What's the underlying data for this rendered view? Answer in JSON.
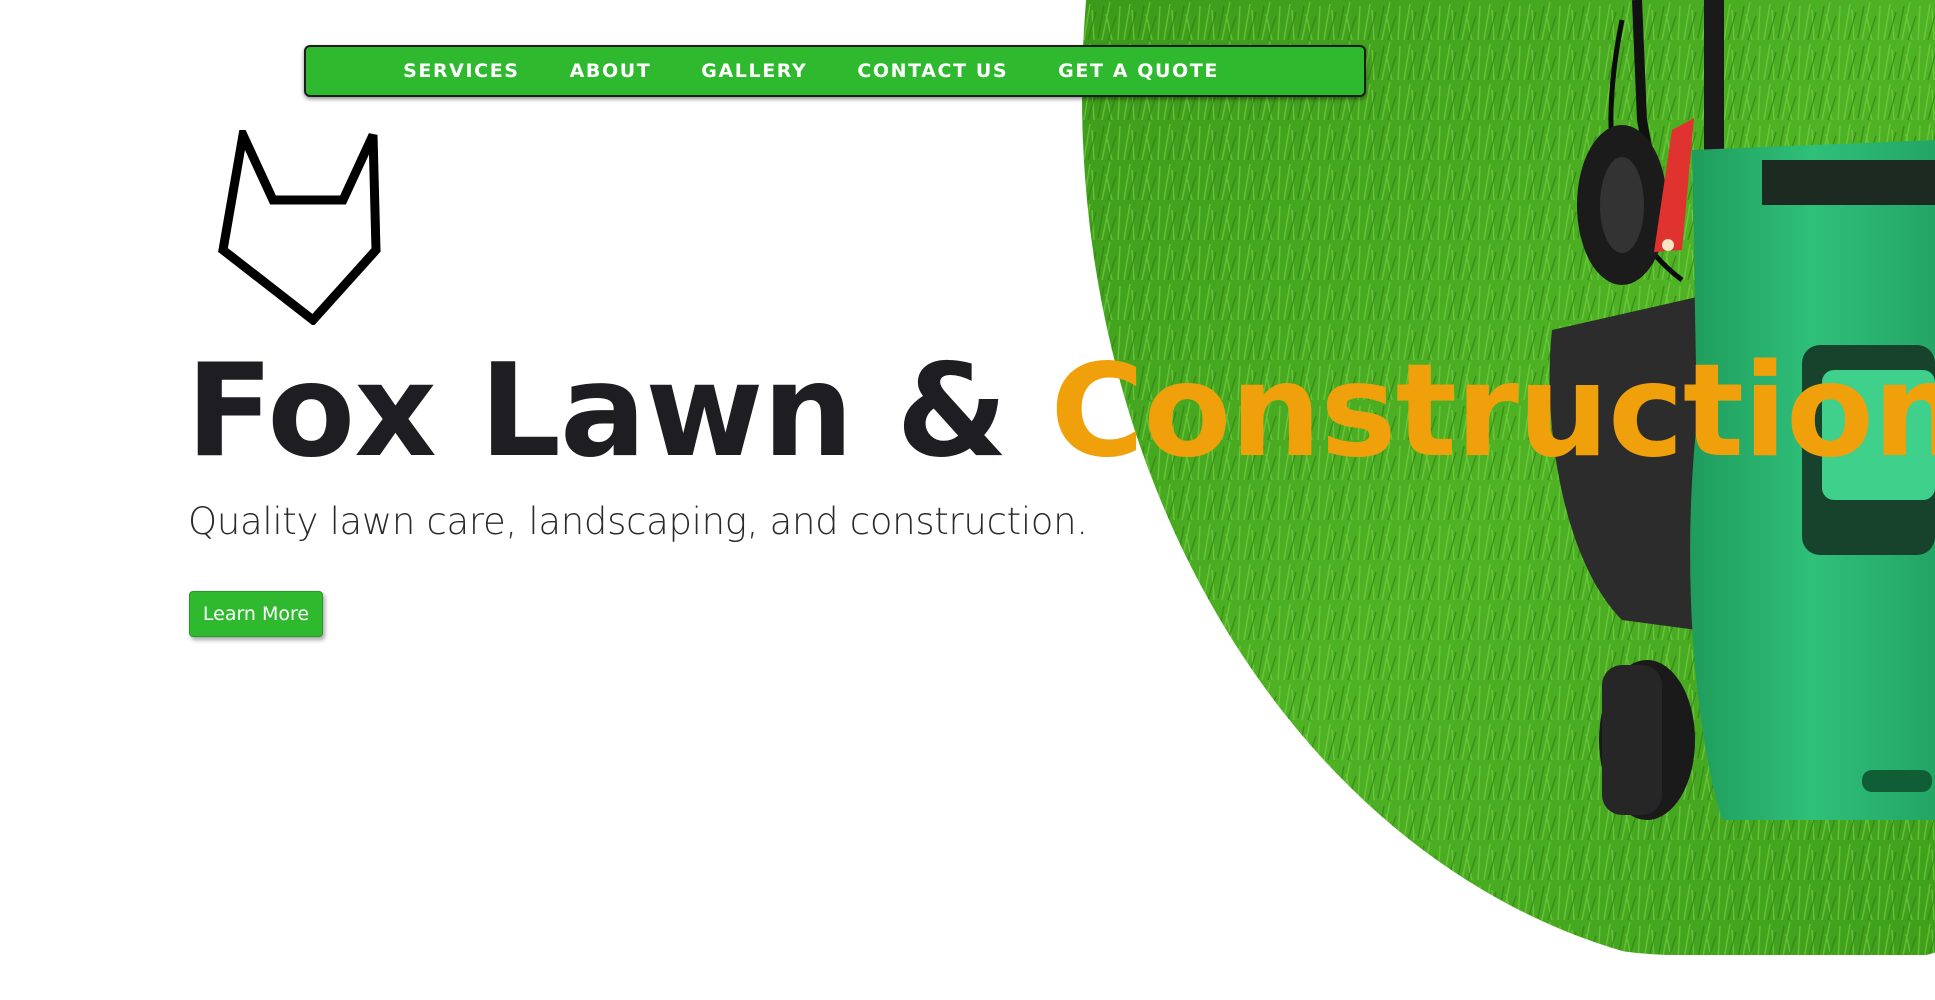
{
  "nav": {
    "items": [
      {
        "label": "SERVICES"
      },
      {
        "label": "ABOUT"
      },
      {
        "label": "GALLERY"
      },
      {
        "label": "CONTACT US"
      },
      {
        "label": "GET A QUOTE"
      }
    ]
  },
  "hero": {
    "title_main": "Fox Lawn & ",
    "title_accent": "Construction",
    "tagline": "Quality lawn care, landscaping, and construction.",
    "cta_label": "Learn More"
  },
  "colors": {
    "brand_green": "#2fb92f",
    "accent_orange": "#f0a00a",
    "title_dark": "#1e1d22"
  },
  "icons": {
    "logo": "fox-head-outline-icon"
  }
}
